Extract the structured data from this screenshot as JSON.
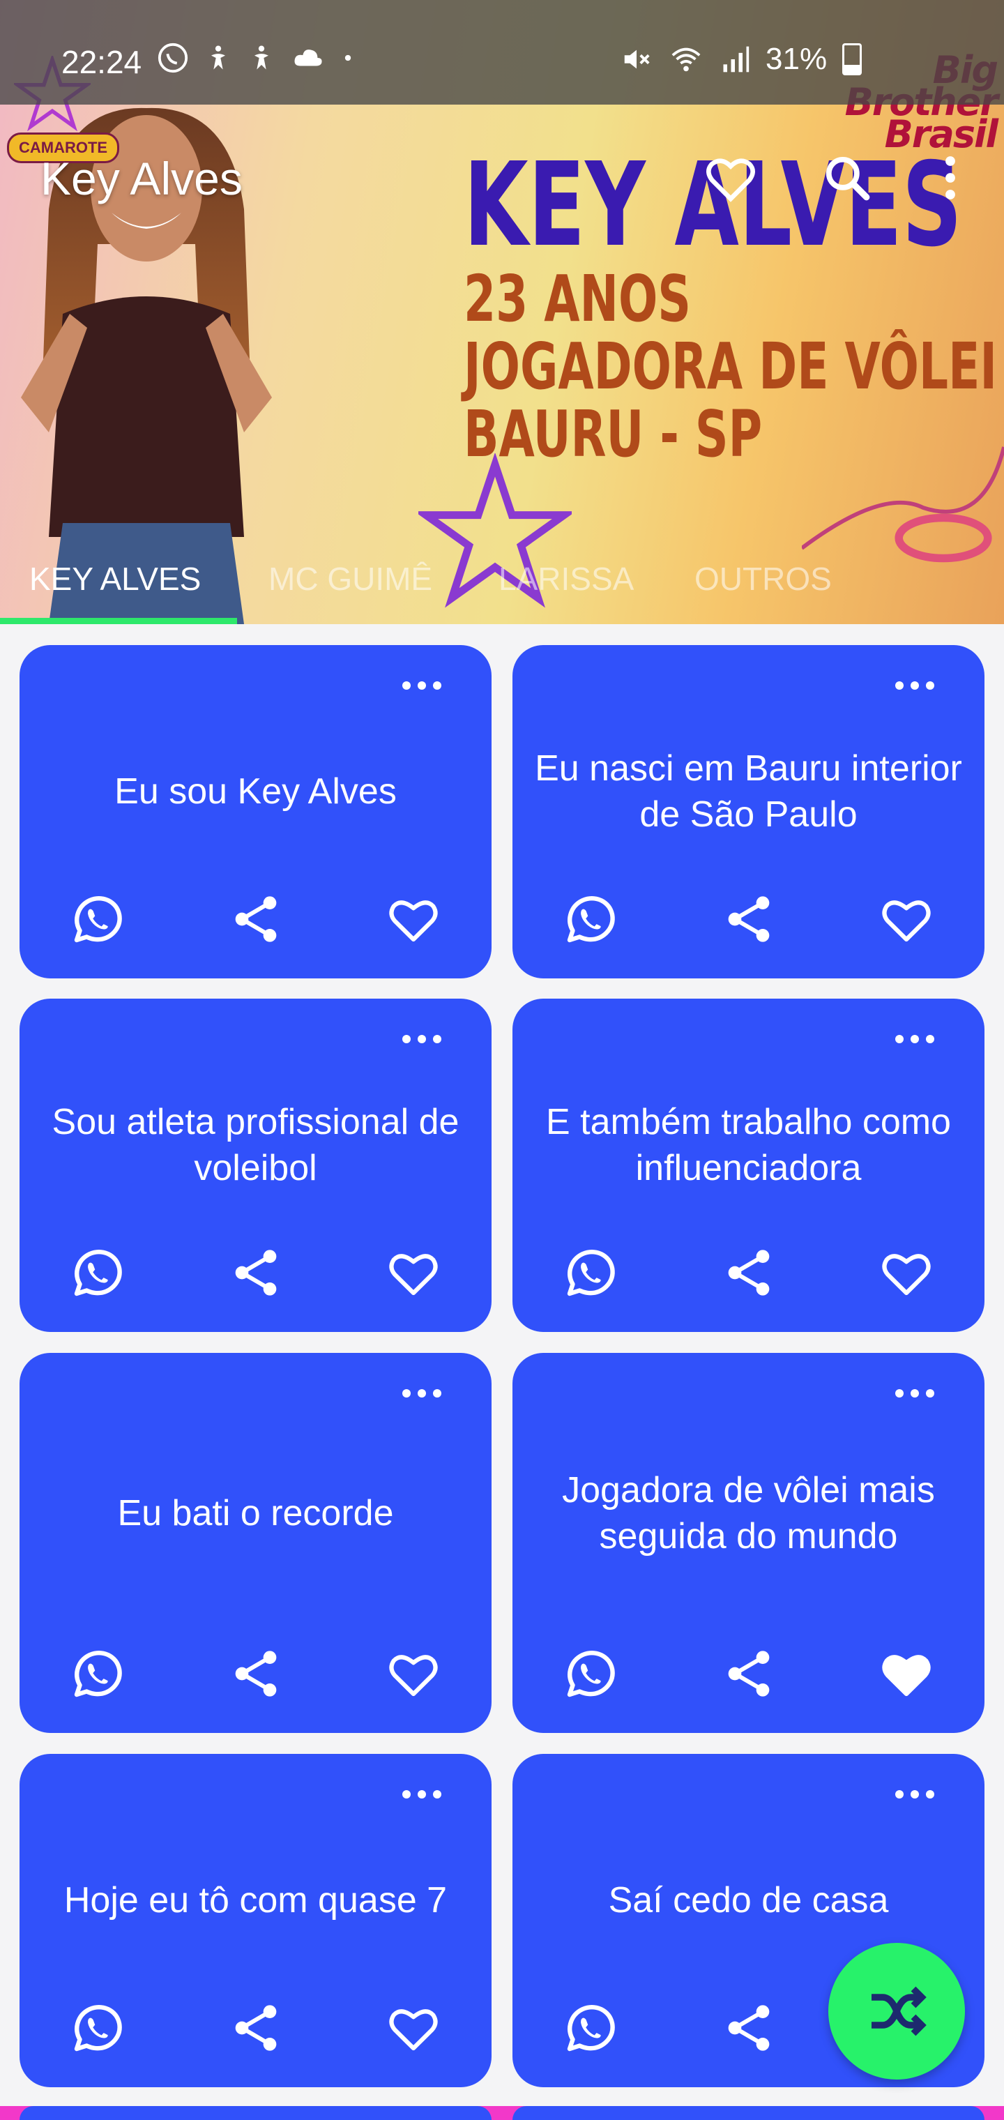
{
  "status_bar": {
    "time": "22:24",
    "battery": "31%",
    "battery_level": 0.31,
    "left_icons": [
      "whatsapp-icon",
      "accessibility-icon",
      "accessibility-icon",
      "cloud-icon",
      "dot-icon"
    ],
    "right_icons": [
      "mute-icon",
      "wifi-icon",
      "signal-icon",
      "battery-icon"
    ]
  },
  "header": {
    "title": "Key Alves",
    "badge": "CAMAROTE",
    "logo_text": [
      "Big Brother",
      "Brasil"
    ],
    "banner": {
      "name": "KEY ALVES",
      "lines": [
        "23 ANOS",
        "JOGADORA DE VÔLEI",
        "BAURU - SP"
      ]
    },
    "actions": [
      "favorite-icon",
      "search-icon",
      "more-vert-icon"
    ]
  },
  "tabs": [
    {
      "label": "KEY ALVES",
      "active": true
    },
    {
      "label": "MC GUIMÊ",
      "active": false
    },
    {
      "label": "LARISSA",
      "active": false
    },
    {
      "label": "OUTROS",
      "active": false
    }
  ],
  "cards": [
    {
      "text": "Eu sou Key Alves",
      "favorited": false
    },
    {
      "text": "Eu nasci em Bauru interior de São Paulo",
      "favorited": false
    },
    {
      "text": "Sou atleta profissional de voleibol",
      "favorited": false
    },
    {
      "text": "E também trabalho como influenciadora",
      "favorited": false
    },
    {
      "text": "Eu bati o recorde",
      "favorited": false
    },
    {
      "text": "Jogadora de vôlei mais seguida do mundo",
      "favorited": true
    },
    {
      "text": "Hoje eu tô com quase 7",
      "favorited": false
    },
    {
      "text": "Saí cedo de casa",
      "favorited": false
    }
  ],
  "colors": {
    "card": "#3151fa",
    "fab": "#27f26a",
    "tab_indicator": "#2ee86b",
    "bottom_strip": "#f238c9"
  },
  "fab": {
    "icon": "shuffle-icon"
  }
}
